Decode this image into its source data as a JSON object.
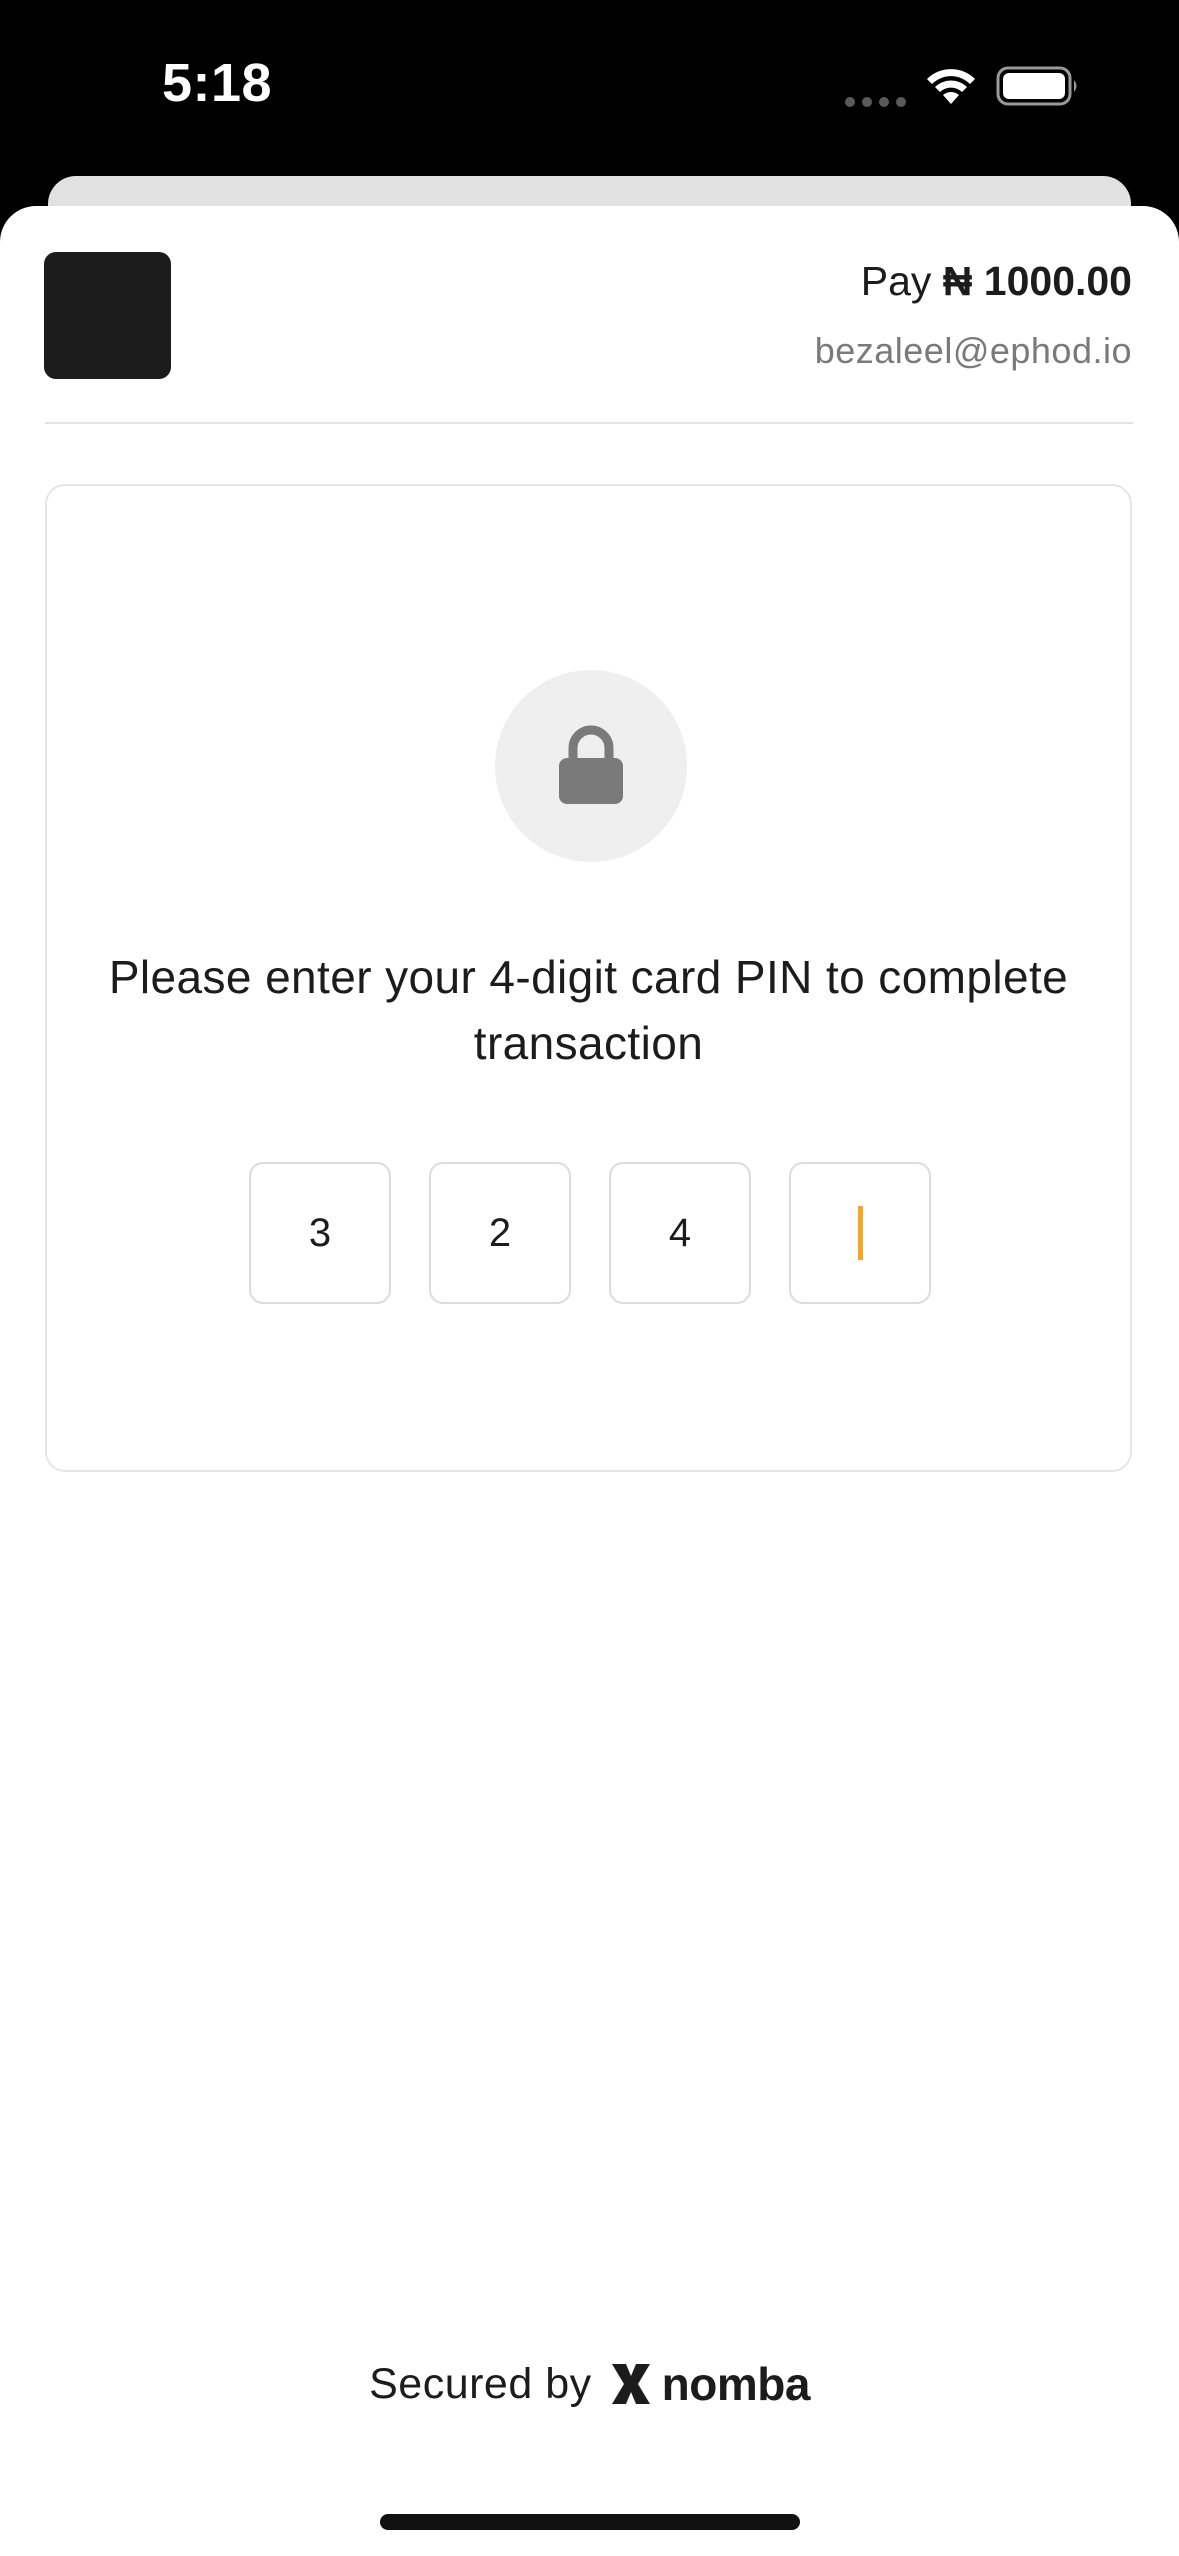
{
  "status_bar": {
    "time": "5:18",
    "icons": [
      "signal-dots-icon",
      "wifi-icon",
      "battery-icon"
    ]
  },
  "header": {
    "pay_label": "Pay",
    "amount": "₦ 1000.00",
    "email": "bezaleel@ephod.io"
  },
  "pin_card": {
    "icon": "lock-icon",
    "instruction": "Please enter your 4-digit card PIN to complete transaction",
    "digits": [
      "3",
      "2",
      "4",
      ""
    ],
    "active_index": 3
  },
  "footer": {
    "secured_text": "Secured by",
    "brand": "nomba"
  },
  "colors": {
    "background": "#ffffff",
    "text": "#1c1c1c",
    "muted": "#7a7a7a",
    "caret": "#f5a623",
    "lock_bg": "#efefef",
    "lock": "#7a7a7a"
  }
}
